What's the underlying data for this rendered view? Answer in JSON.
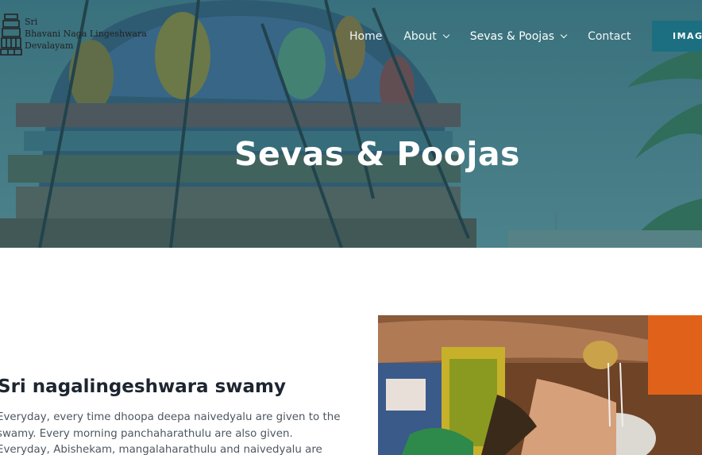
{
  "header": {
    "logo": {
      "lines": [
        "Sri",
        "Bhavani Naga Lingeshwara",
        "Devalayam"
      ]
    },
    "nav": [
      {
        "label": "Home",
        "has_dropdown": false,
        "active": false
      },
      {
        "label": "About",
        "has_dropdown": true,
        "active": false
      },
      {
        "label": "Sevas & Poojas",
        "has_dropdown": true,
        "active": true
      },
      {
        "label": "Contact",
        "has_dropdown": false,
        "active": false
      }
    ],
    "cta_label": "IMAGE"
  },
  "hero": {
    "title": "Sevas & Poojas"
  },
  "content": {
    "section_title": "Sri nagalingeshwara swamy",
    "section_body": "Everyday, every time dhoopa deepa naivedyalu are given to the swamy. Every morning panchaharathulu are also given. Everyday, Abishekam, mangalaharathulu and naivedyalu are"
  },
  "colors": {
    "accent": "#1b6f80",
    "hero_overlay": "#2f6f7e",
    "heading": "#1d2530",
    "body_text": "#4e5660"
  },
  "icons": [
    "temple-logo-icon",
    "chevron-down-icon"
  ]
}
